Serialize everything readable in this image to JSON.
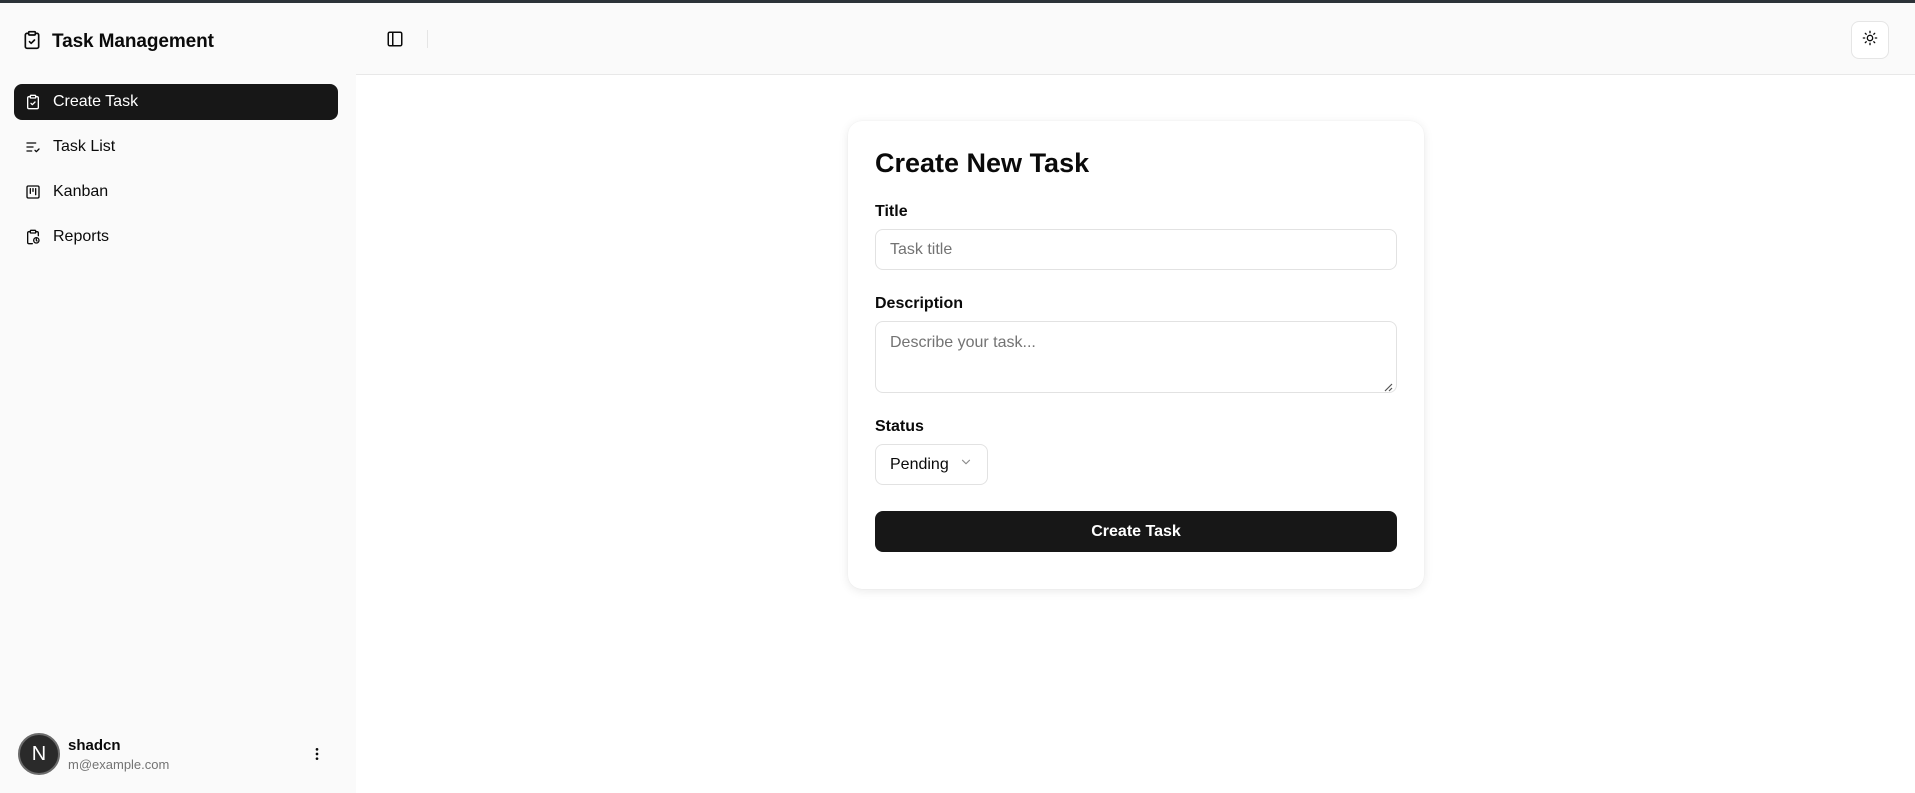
{
  "app": {
    "title": "Task Management"
  },
  "sidebar": {
    "items": [
      {
        "label": "Create Task",
        "icon": "clipboard-check-icon",
        "active": true
      },
      {
        "label": "Task List",
        "icon": "list-check-icon",
        "active": false
      },
      {
        "label": "Kanban",
        "icon": "kanban-icon",
        "active": false
      },
      {
        "label": "Reports",
        "icon": "clipboard-report-icon",
        "active": false
      }
    ],
    "user": {
      "initial": "N",
      "name": "shadcn",
      "email": "m@example.com"
    }
  },
  "header": {
    "toggle_icon": "sidebar-toggle-icon",
    "theme_icon": "sun-icon"
  },
  "form": {
    "heading": "Create New Task",
    "title_label": "Title",
    "title_placeholder": "Task title",
    "description_label": "Description",
    "description_placeholder": "Describe your task...",
    "status_label": "Status",
    "status_value": "Pending",
    "submit_label": "Create Task"
  },
  "colors": {
    "accent": "#171717",
    "sidebar_bg": "#fafafa",
    "border": "#e2e2e2",
    "muted_text": "#737373"
  }
}
